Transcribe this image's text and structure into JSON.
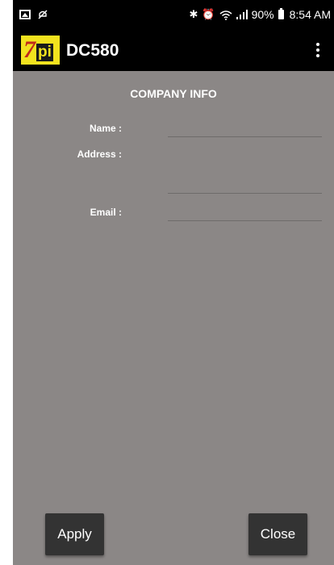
{
  "status_bar": {
    "left_icons": [
      "image-icon",
      "mute-icon"
    ],
    "bluetooth_symbol": "✱",
    "alarm_symbol": "⏰",
    "wifi_symbol": "📶",
    "battery_percent": "90%",
    "time": "8:54 AM"
  },
  "app_bar": {
    "logo_seven": "7",
    "logo_pi": "pi",
    "title": "DC580",
    "menu_icon": "overflow-menu-icon"
  },
  "form": {
    "section_title": "COMPANY INFO",
    "name_label": "Name :",
    "name_value": "",
    "address_label": "Address :",
    "address_value": "",
    "email_label": "Email :",
    "email_value": ""
  },
  "buttons": {
    "apply_label": "Apply",
    "close_label": "Close"
  },
  "colors": {
    "background": "#8b8786",
    "bar": "#000000",
    "button": "#333333",
    "logo_yellow": "#f2e21e",
    "logo_red": "#c02a1c"
  }
}
